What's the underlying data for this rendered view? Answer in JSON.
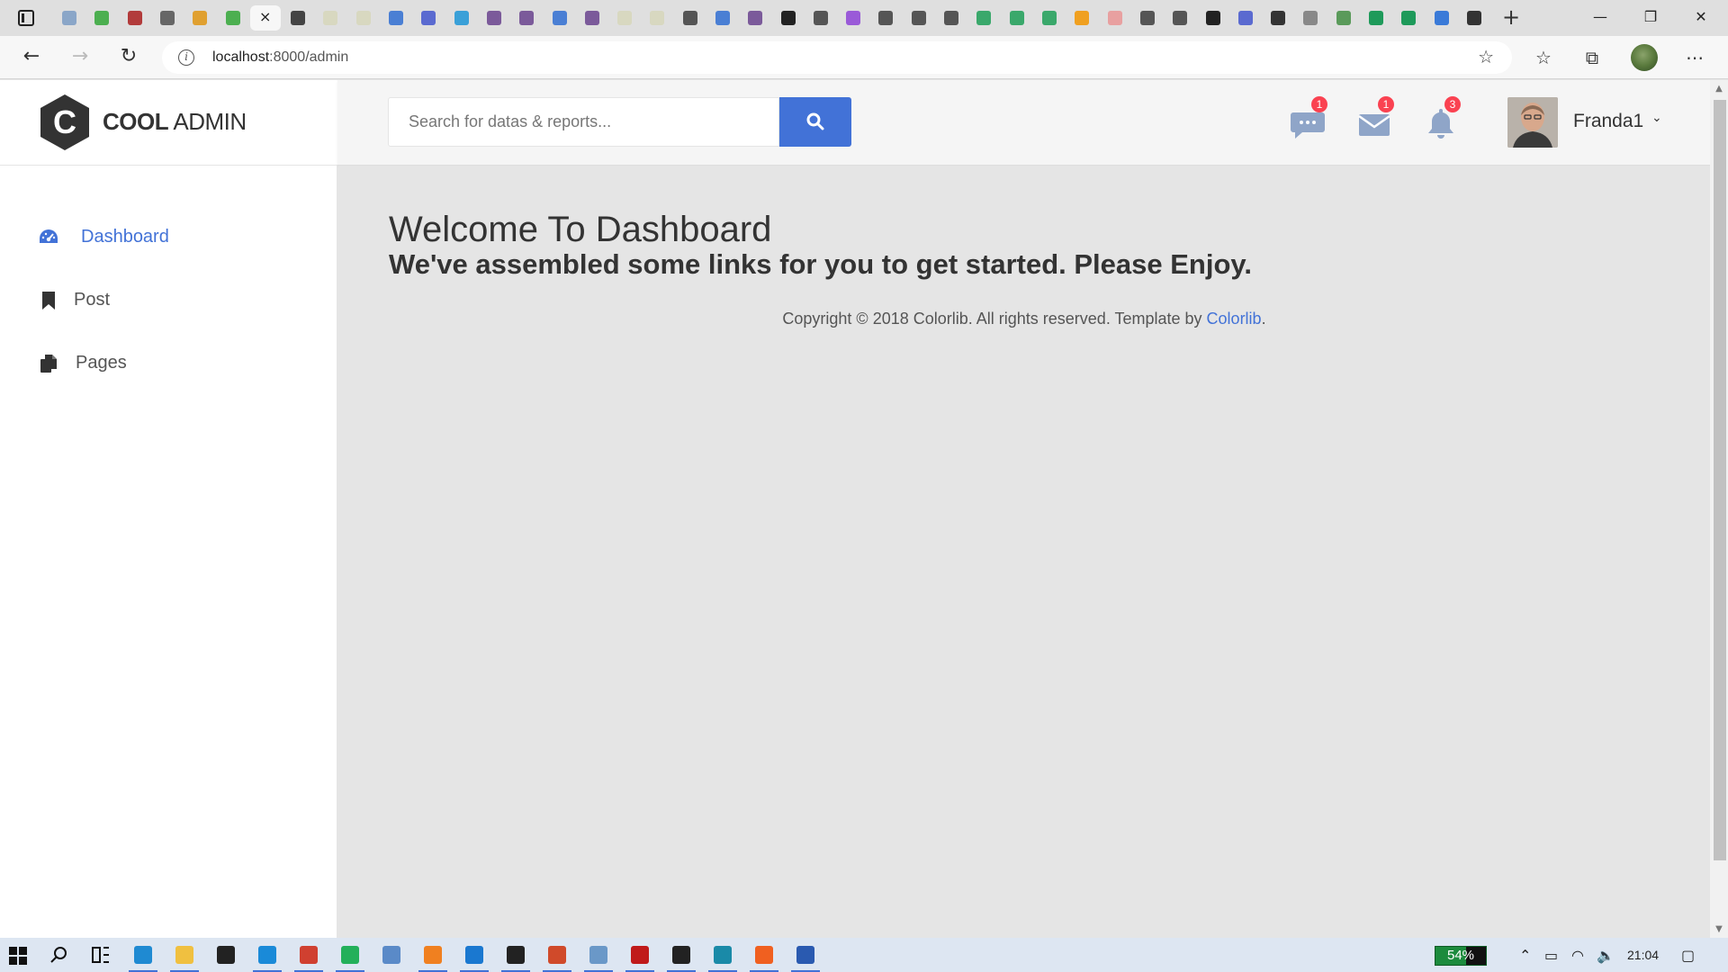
{
  "browser": {
    "url_host": "localhost",
    "url_path": ":8000/admin",
    "tabs": [
      {
        "name": "tab-1",
        "color": "#8aa6c8"
      },
      {
        "name": "tab-2",
        "color": "#4caf50"
      },
      {
        "name": "tab-3",
        "color": "#b23b3b"
      },
      {
        "name": "tab-4",
        "color": "#666666"
      },
      {
        "name": "tab-5",
        "color": "#e0a030"
      },
      {
        "name": "tab-6",
        "color": "#4caf50"
      },
      {
        "name": "tab-active",
        "color": "#f7f7f7"
      },
      {
        "name": "tab-8",
        "color": "#444444"
      },
      {
        "name": "tab-9",
        "color": "#d8d8c0"
      },
      {
        "name": "tab-10",
        "color": "#d8d8c0"
      },
      {
        "name": "tab-11",
        "color": "#4a7fd4"
      },
      {
        "name": "tab-12",
        "color": "#5a6ad0"
      },
      {
        "name": "tab-13",
        "color": "#3aa0d8"
      },
      {
        "name": "tab-14",
        "color": "#7b5a9a"
      },
      {
        "name": "tab-15",
        "color": "#7b5a9a"
      },
      {
        "name": "tab-16",
        "color": "#4a7fd4"
      },
      {
        "name": "tab-17",
        "color": "#7b5a9a"
      },
      {
        "name": "tab-18",
        "color": "#d8d8c0"
      },
      {
        "name": "tab-19",
        "color": "#d8d8c0"
      },
      {
        "name": "tab-20",
        "color": "#555555"
      },
      {
        "name": "tab-21",
        "color": "#4a7fd4"
      },
      {
        "name": "tab-22",
        "color": "#7b5a9a"
      },
      {
        "name": "tab-23",
        "color": "#222222"
      },
      {
        "name": "tab-24",
        "color": "#555555"
      },
      {
        "name": "tab-25",
        "color": "#9a5ad8"
      },
      {
        "name": "tab-26",
        "color": "#555555"
      },
      {
        "name": "tab-27",
        "color": "#555555"
      },
      {
        "name": "tab-28",
        "color": "#555555"
      },
      {
        "name": "tab-29",
        "color": "#3aa86b"
      },
      {
        "name": "tab-30",
        "color": "#3aa86b"
      },
      {
        "name": "tab-31",
        "color": "#3aa86b"
      },
      {
        "name": "tab-32",
        "color": "#f0a020"
      },
      {
        "name": "tab-33",
        "color": "#e8a0a0"
      },
      {
        "name": "tab-34",
        "color": "#555555"
      },
      {
        "name": "tab-35",
        "color": "#555555"
      },
      {
        "name": "tab-36",
        "color": "#222222"
      },
      {
        "name": "tab-37",
        "color": "#5a6ad0"
      },
      {
        "name": "tab-38",
        "color": "#333333"
      },
      {
        "name": "tab-39",
        "color": "#888888"
      },
      {
        "name": "tab-40",
        "color": "#5a9a5a"
      },
      {
        "name": "tab-41",
        "color": "#1e9a5a"
      },
      {
        "name": "tab-42",
        "color": "#1e9a5a"
      },
      {
        "name": "tab-43",
        "color": "#3a7ad8"
      },
      {
        "name": "tab-44",
        "color": "#333333"
      }
    ],
    "tab_close_glyph": "×",
    "new_tab_glyph": "+",
    "window_controls": {
      "minimize": "—",
      "restore": "❐",
      "close": "✕"
    },
    "nav": {
      "back": "←",
      "forward": "→",
      "reload": "↻",
      "info": "i",
      "star": "☆"
    },
    "toolbar_icons": {
      "favorites": "☆",
      "collections": "⧉",
      "menu": "⋯"
    }
  },
  "app": {
    "logo_text_bold": "COOL",
    "logo_text_light": "ADMIN",
    "logo_letter": "C",
    "search_placeholder": "Search for datas & reports...",
    "notifications": {
      "chat_count": "1",
      "mail_count": "1",
      "bell_count": "3"
    },
    "user_name": "Franda1",
    "user_caret": "⌄",
    "sidebar": [
      {
        "label": "Dashboard",
        "icon": "tachometer-icon",
        "active": true
      },
      {
        "label": "Post",
        "icon": "bookmark-icon",
        "active": false
      },
      {
        "label": "Pages",
        "icon": "copy-icon",
        "active": false
      }
    ],
    "welcome_title": "Welcome To Dashboard",
    "welcome_subtitle": "We've assembled some links for you to get started. Please Enjoy.",
    "copyright_text": "Copyright © 2018 Colorlib. All rights reserved. Template by ",
    "copyright_link": "Colorlib",
    "copyright_end": "."
  },
  "colors": {
    "accent": "#4272d7",
    "badge": "#fa4251",
    "icon_muted": "#8fa5c8",
    "sidebar_bg": "#ffffff",
    "content_bg": "#e5e5e5"
  },
  "taskbar": {
    "battery_text": "54%",
    "time": "21:04",
    "tray": {
      "chevron": "⌃",
      "battery": "▭",
      "wifi": "◠",
      "volume": "🔈",
      "notifications": "▢"
    }
  }
}
